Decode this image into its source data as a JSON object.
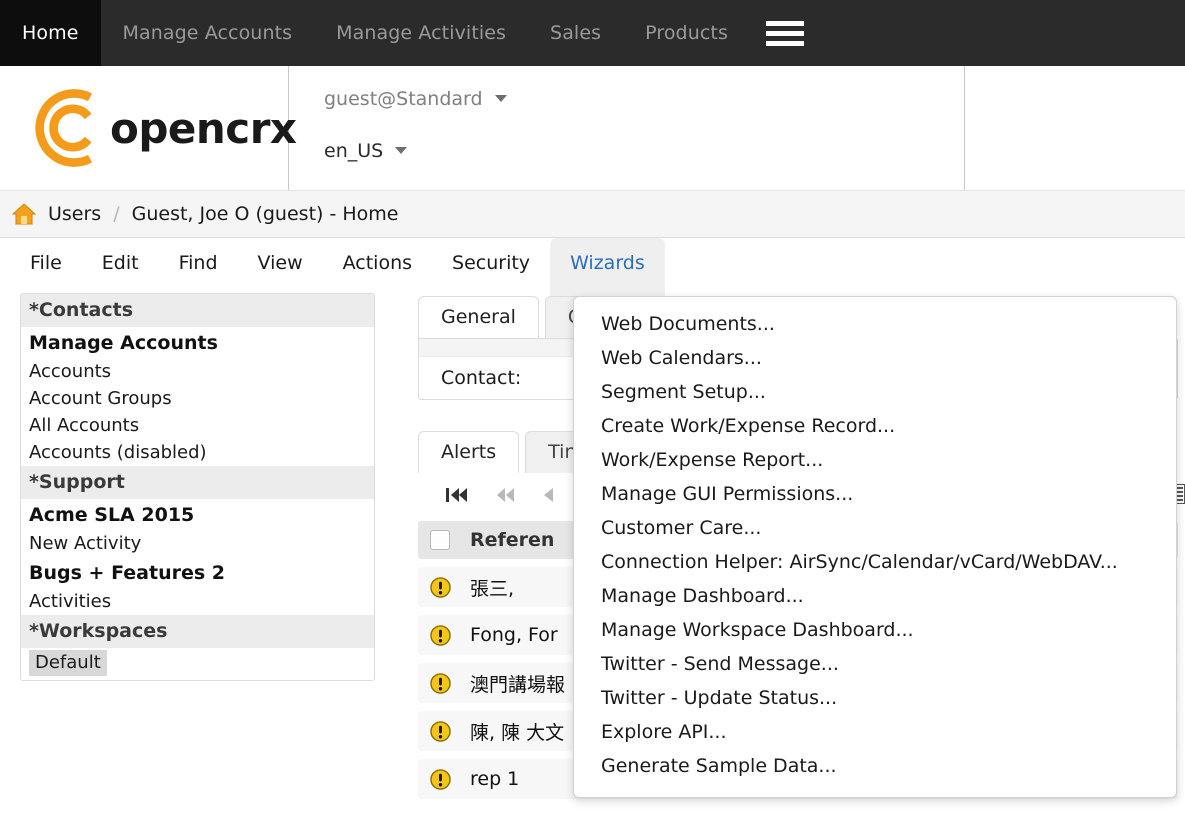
{
  "topnav": {
    "items": [
      {
        "label": "Home",
        "active": true
      },
      {
        "label": "Manage Accounts",
        "active": false
      },
      {
        "label": "Manage Activities",
        "active": false
      },
      {
        "label": "Sales",
        "active": false
      },
      {
        "label": "Products",
        "active": false
      }
    ],
    "menu_icon": "hamburger-icon"
  },
  "brand": {
    "logo_text": "opencrx",
    "logo_color": "#f59b1c",
    "session_user": "guest@Standard",
    "locale": "en_US"
  },
  "breadcrumb": {
    "home_icon": "home-icon",
    "root": "Users",
    "separator": "/",
    "current": "Guest, Joe O (guest) - Home"
  },
  "menubar": {
    "items": [
      {
        "label": "File",
        "open": false
      },
      {
        "label": "Edit",
        "open": false
      },
      {
        "label": "Find",
        "open": false
      },
      {
        "label": "View",
        "open": false
      },
      {
        "label": "Actions",
        "open": false
      },
      {
        "label": "Security",
        "open": false
      },
      {
        "label": "Wizards",
        "open": true
      }
    ],
    "active_accent": "#2a6ebb"
  },
  "sidebar": {
    "sections": [
      {
        "title": "*Contacts",
        "entries": [
          {
            "label": "Manage Accounts",
            "style": "bold"
          },
          {
            "label": "Accounts",
            "style": "link"
          },
          {
            "label": "Account Groups",
            "style": "link"
          },
          {
            "label": "All Accounts",
            "style": "link"
          },
          {
            "label": "Accounts (disabled)",
            "style": "link"
          }
        ]
      },
      {
        "title": "*Support",
        "entries": [
          {
            "label": "Acme SLA 2015",
            "style": "bold"
          },
          {
            "label": "New Activity",
            "style": "link"
          },
          {
            "label": "Bugs + Features 2",
            "style": "bold"
          },
          {
            "label": "Activities",
            "style": "link"
          }
        ]
      },
      {
        "title": "*Workspaces",
        "entries": [
          {
            "label": "Default",
            "style": "selected"
          }
        ]
      }
    ]
  },
  "content": {
    "tabs": [
      {
        "label": "General",
        "active": true
      },
      {
        "label": "C",
        "active": false
      },
      {
        "label": "",
        "active": false
      },
      {
        "label": "",
        "active": false
      },
      {
        "label": "",
        "active": false
      }
    ],
    "form": {
      "field_label": "Contact:"
    },
    "subtabs": [
      {
        "label": "Alerts",
        "active": true
      },
      {
        "label": "Tin",
        "active": false
      }
    ],
    "pager": {
      "first": "first-page-icon",
      "rewind": "rewind-page-icon",
      "prev": "previous-page-icon",
      "next": "next-page-icon"
    },
    "grid": {
      "header": "Referen",
      "select_all": "select-all-checkbox",
      "rows": [
        {
          "icon": "alert-icon",
          "reference": "張三,"
        },
        {
          "icon": "alert-icon",
          "reference": "Fong, For"
        },
        {
          "icon": "alert-icon",
          "reference": "澳門講場報"
        },
        {
          "icon": "alert-icon",
          "reference": "陳, 陳 大文"
        },
        {
          "icon": "alert-icon",
          "reference": "rep 1"
        }
      ]
    },
    "edge_icon": "grid-view-icon"
  },
  "wizards_menu": {
    "items": [
      "Web Documents...",
      "Web Calendars...",
      "Segment Setup...",
      "Create Work/Expense Record...",
      "Work/Expense Report...",
      "Manage GUI Permissions...",
      "Customer Care...",
      "Connection Helper: AirSync/Calendar/vCard/WebDAV...",
      "Manage Dashboard...",
      "Manage Workspace Dashboard...",
      "Twitter - Send Message...",
      "Twitter - Update Status...",
      "Explore API...",
      "Generate Sample Data..."
    ]
  }
}
